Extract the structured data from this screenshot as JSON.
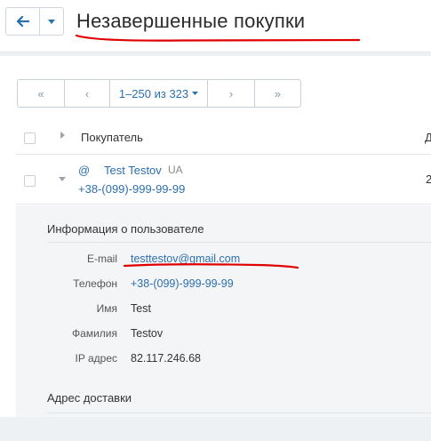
{
  "header": {
    "title": "Незавершенные покупки",
    "back_icon": "arrow-left-icon",
    "caret_icon": "caret-down-icon",
    "accent": "#2c6fad"
  },
  "pagination": {
    "first": "«",
    "prev": "‹",
    "range": "1–250 из 323",
    "next": "›",
    "last": "»"
  },
  "table": {
    "column_customer": "Покупатель",
    "column_next_partial": "Д",
    "row": {
      "at_symbol": "@",
      "name": "Test Testov",
      "country": "UA",
      "phone": "+38-(099)-999-99-99",
      "next_partial": "2"
    }
  },
  "details": {
    "section_title": "Информация о пользователе",
    "fields": [
      {
        "label": "E-mail",
        "value": "testtestov@gmail.com"
      },
      {
        "label": "Телефон",
        "value": "+38-(099)-999-99-99"
      },
      {
        "label": "Имя",
        "value": "Test"
      },
      {
        "label": "Фамилия",
        "value": "Testov"
      },
      {
        "label": "IP адрес",
        "value": "82.117.246.68"
      }
    ],
    "section2_title": "Адрес доставки"
  },
  "annotation_color": "#e00000"
}
